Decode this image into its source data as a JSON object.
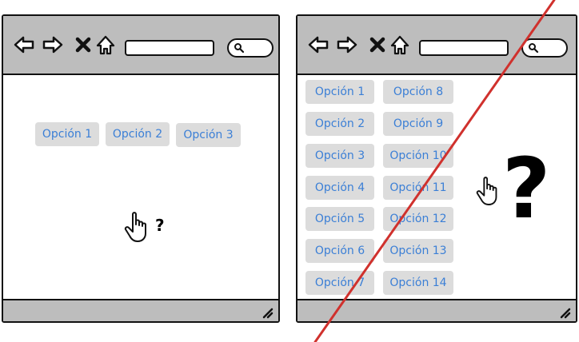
{
  "icons": {
    "back": "arrow-left-icon",
    "forward": "arrow-right-icon",
    "stop": "close-icon",
    "home": "home-icon",
    "search": "search-icon",
    "resize": "resize-grip-icon",
    "cursor": "hand-pointer-icon"
  },
  "left_window": {
    "options": [
      "Opción 1",
      "Opción 2",
      "Opción 3"
    ],
    "question_mark": "?"
  },
  "right_window": {
    "options": [
      "Opción 1",
      "Opción 2",
      "Opción 3",
      "Opción 4",
      "Opción 5",
      "Opción 6",
      "Opción 7",
      "Opción 8",
      "Opción 9",
      "Opción 10",
      "Opción 11",
      "Opción 12",
      "Opción 13",
      "Opción 14"
    ],
    "question_mark": "?"
  },
  "colors": {
    "option_text": "#3b7fd6",
    "option_bg": "#dcdcdc",
    "chrome": "#bdbdbd",
    "strike_line": "#d0312d"
  }
}
